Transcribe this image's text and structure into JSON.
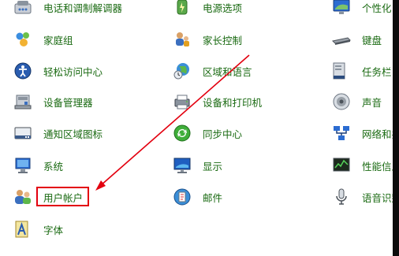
{
  "control_panel": {
    "items": [
      {
        "label": "电话和调制解调器",
        "icon": "phone-modem-icon"
      },
      {
        "label": "电源选项",
        "icon": "power-options-icon"
      },
      {
        "label": "个性化",
        "icon": "personalization-icon"
      },
      {
        "label": "家庭组",
        "icon": "homegroup-icon"
      },
      {
        "label": "家长控制",
        "icon": "parental-controls-icon"
      },
      {
        "label": "键盘",
        "icon": "keyboard-icon"
      },
      {
        "label": "轻松访问中心",
        "icon": "ease-of-access-icon"
      },
      {
        "label": "区域和语言",
        "icon": "region-language-icon"
      },
      {
        "label": "任务栏",
        "icon": "taskbar-icon"
      },
      {
        "label": "设备管理器",
        "icon": "device-manager-icon"
      },
      {
        "label": "设备和打印机",
        "icon": "devices-printers-icon"
      },
      {
        "label": "声音",
        "icon": "sound-icon"
      },
      {
        "label": "通知区域图标",
        "icon": "notification-area-icon"
      },
      {
        "label": "同步中心",
        "icon": "sync-center-icon"
      },
      {
        "label": "网络和共",
        "icon": "network-sharing-icon"
      },
      {
        "label": "系统",
        "icon": "system-icon"
      },
      {
        "label": "显示",
        "icon": "display-icon"
      },
      {
        "label": "性能信息",
        "icon": "performance-icon"
      },
      {
        "label": "用户帐户",
        "icon": "user-accounts-icon"
      },
      {
        "label": "邮件",
        "icon": "mail-icon"
      },
      {
        "label": "语音识别",
        "icon": "speech-recognition-icon"
      },
      {
        "label": "字体",
        "icon": "fonts-icon"
      }
    ]
  },
  "annotation": {
    "highlight_color": "#e3000f",
    "highlighted_item": "用户帐户"
  },
  "colors": {
    "link_text": "#1a6a12",
    "background": "#ffffff"
  }
}
